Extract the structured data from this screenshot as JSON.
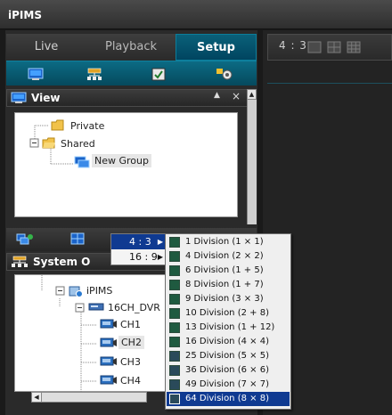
{
  "app": {
    "title": "iPIMS"
  },
  "tabs": {
    "live": "Live",
    "playback": "Playback",
    "setup": "Setup"
  },
  "view_panel": {
    "title": "View",
    "tree": [
      {
        "label": "Private"
      },
      {
        "label": "Shared"
      },
      {
        "label": "New Group"
      }
    ]
  },
  "system_panel": {
    "title": "System O",
    "tree": [
      {
        "label": "iPIMS"
      },
      {
        "label": "16CH_DVR"
      },
      {
        "label": "CH1"
      },
      {
        "label": "CH2"
      },
      {
        "label": "CH3"
      },
      {
        "label": "CH4"
      }
    ]
  },
  "right_toolbar": {
    "ratio": "4 : 3"
  },
  "ratio_menu": {
    "items": [
      "4 : 3",
      "16 : 9"
    ]
  },
  "division_menu": {
    "items": [
      "1 Division (1 × 1)",
      "4 Division (2 × 2)",
      "6 Division (1 + 5)",
      "8 Division (1 + 7)",
      "9 Division (3 × 3)",
      "10 Division (2 + 8)",
      "13 Division (1 + 12)",
      "16 Division (4 × 4)",
      "25 Division (5 × 5)",
      "36 Division (6 × 6)",
      "49 Division (7 × 7)",
      "64 Division (8 × 8)"
    ],
    "selected_index": 11
  },
  "colors": {
    "accent": "#0a5f78",
    "menu_highlight": "#0f3a91"
  }
}
